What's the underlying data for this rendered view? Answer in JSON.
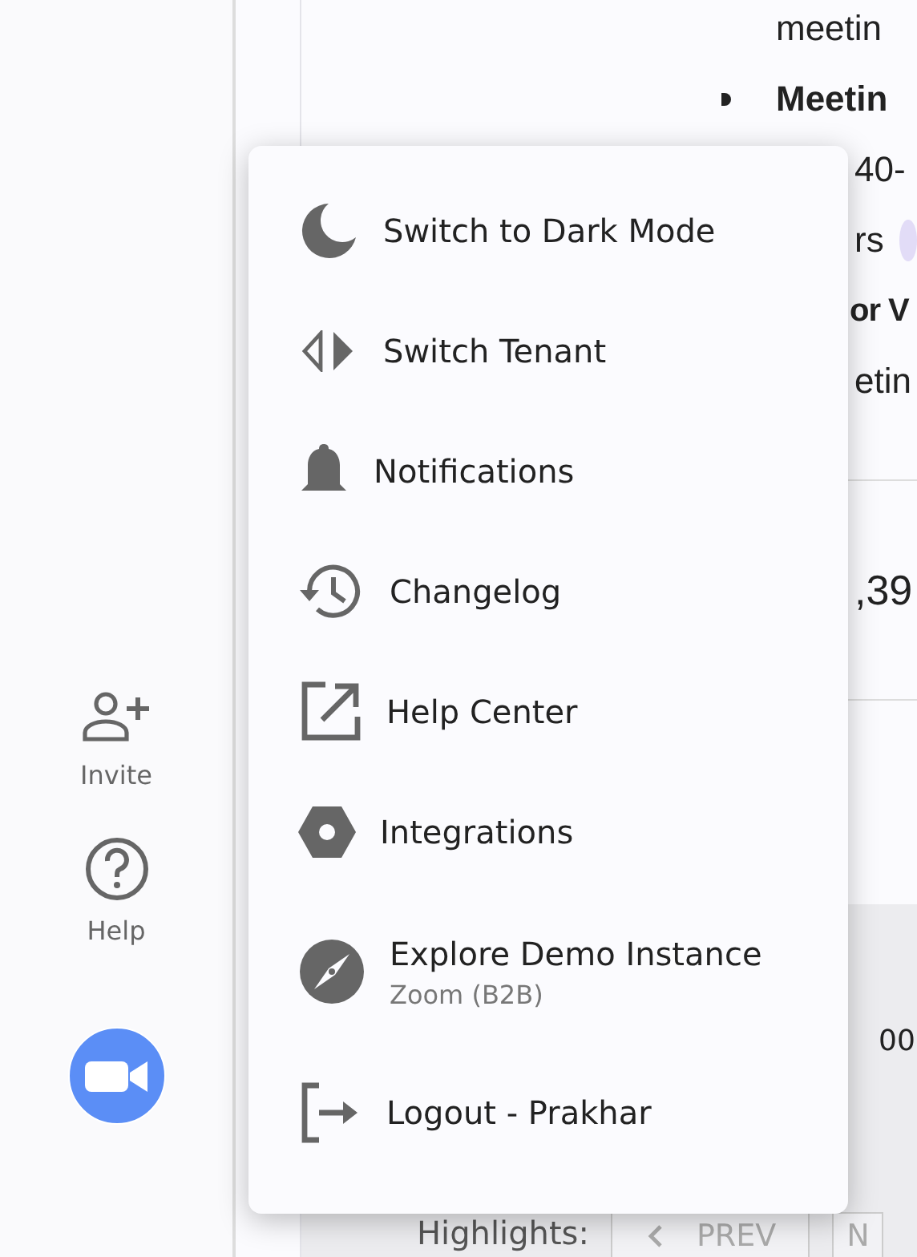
{
  "sidebar": {
    "items": [
      {
        "label": "Invite"
      },
      {
        "label": "Help"
      }
    ]
  },
  "content": {
    "lines": [
      {
        "text": "meetin",
        "bold": false
      },
      {
        "text": "Meetin",
        "bold": true,
        "bullet": true
      },
      {
        "text": "40-",
        "bold": false
      },
      {
        "text": "rs",
        "bold": false
      },
      {
        "text": "or V",
        "bold": true
      },
      {
        "text": "etin",
        "bold": false
      }
    ],
    "stat": ",39",
    "time": "00"
  },
  "highlights": {
    "label": "Highlights:",
    "prev": "PREV",
    "next": "N"
  },
  "menu": {
    "items": [
      {
        "label": "Switch to Dark Mode"
      },
      {
        "label": "Switch Tenant"
      },
      {
        "label": "Notifications"
      },
      {
        "label": "Changelog"
      },
      {
        "label": "Help Center"
      },
      {
        "label": "Integrations"
      },
      {
        "label": "Explore Demo Instance",
        "sublabel": "Zoom (B2B)"
      },
      {
        "label": "Logout - Prakhar"
      }
    ]
  }
}
